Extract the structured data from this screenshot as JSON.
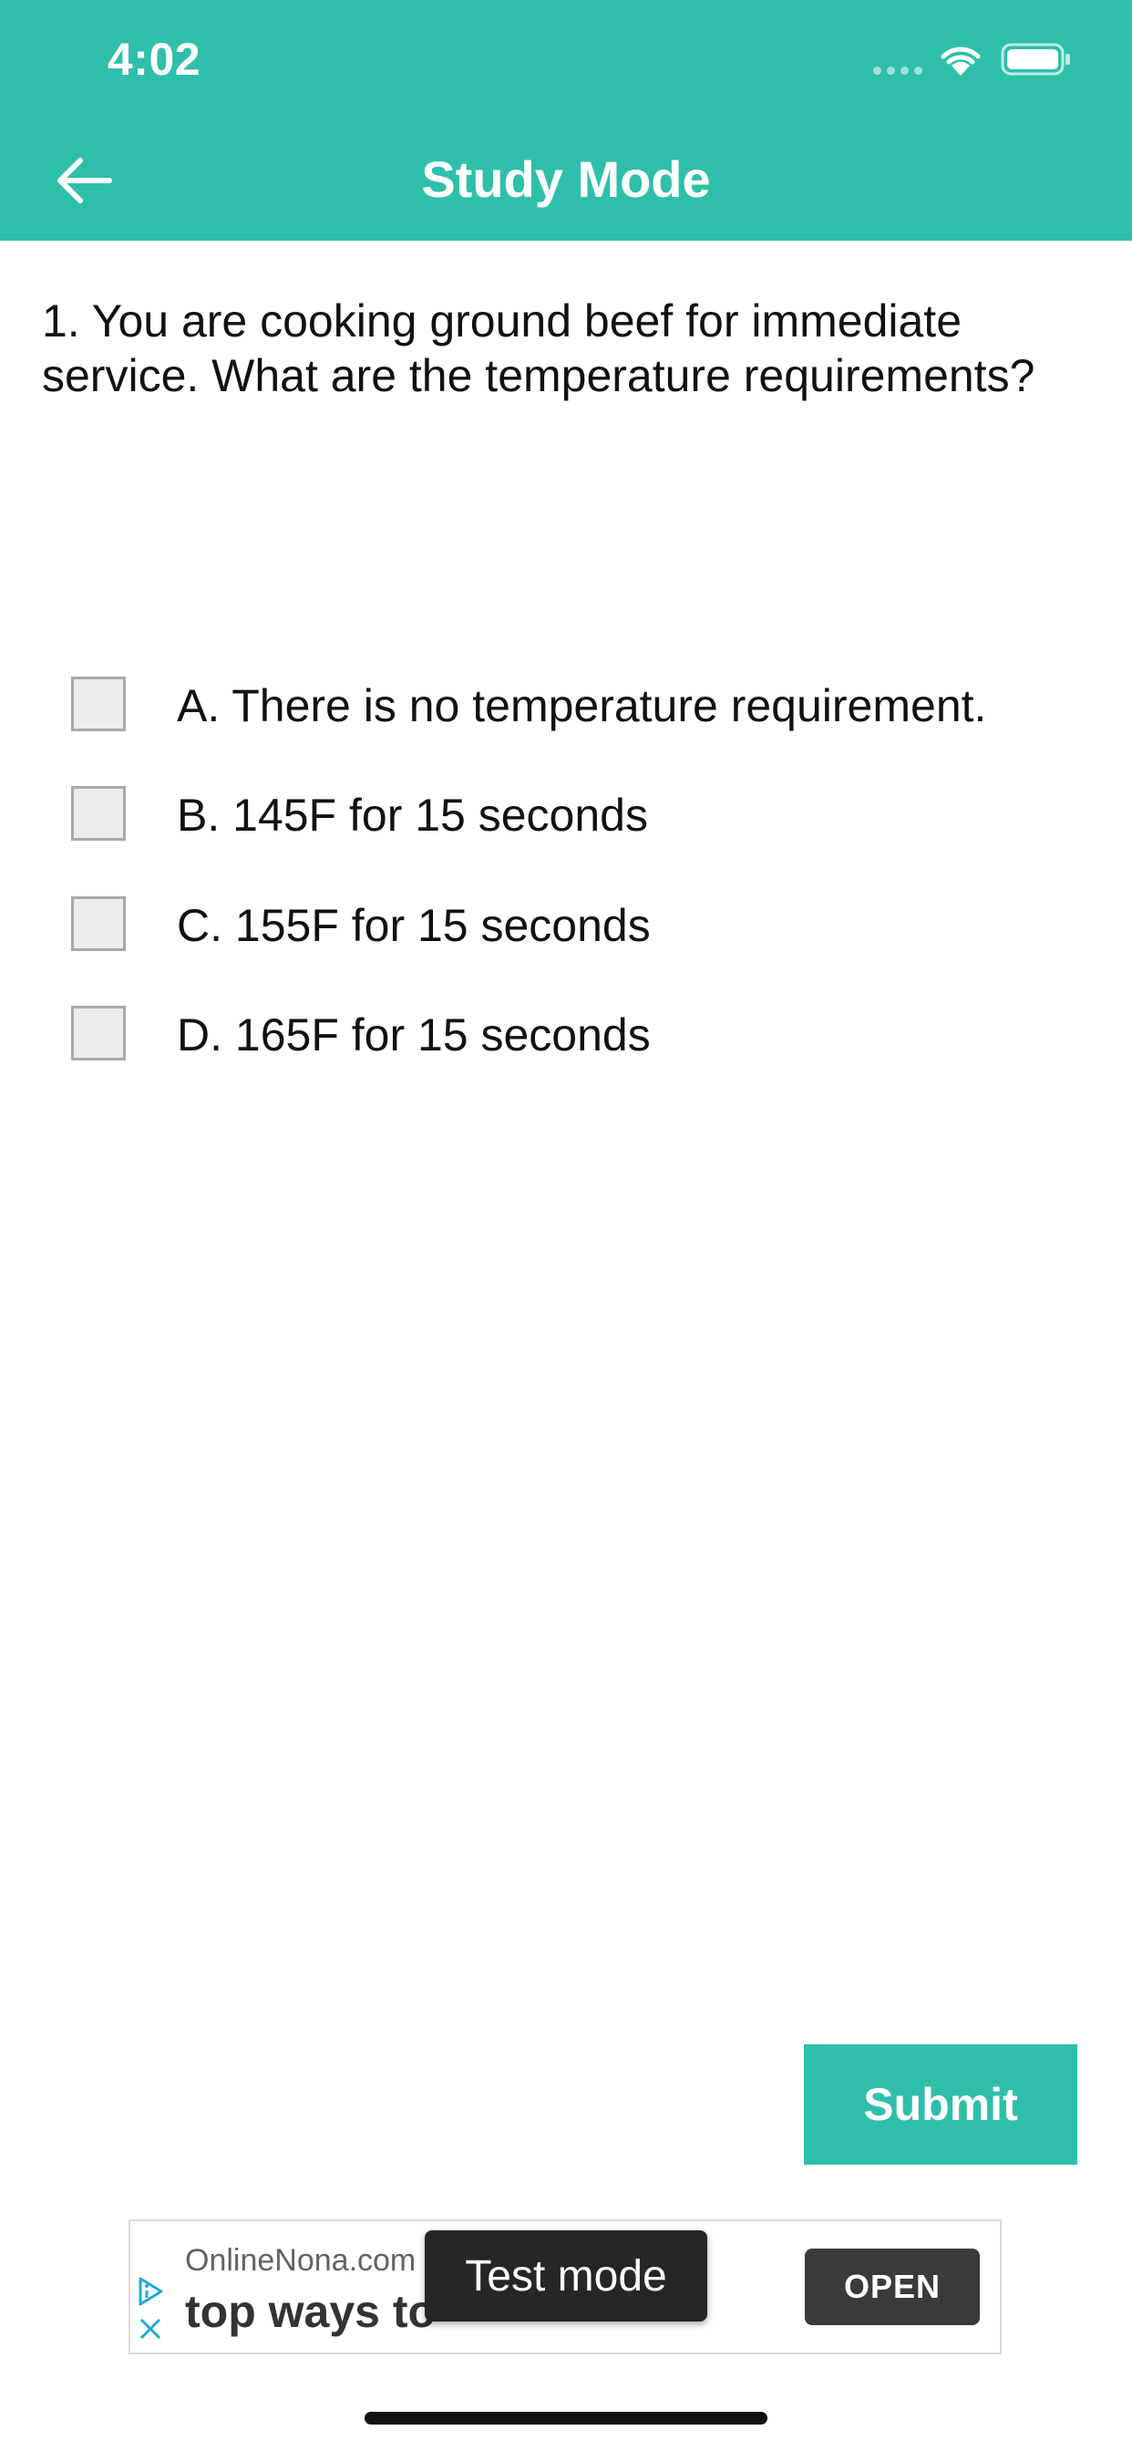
{
  "status_bar": {
    "time": "4:02",
    "icons": [
      "cellular-signal-icon",
      "wifi-icon",
      "battery-icon"
    ]
  },
  "nav": {
    "title": "Study Mode",
    "back_icon": "back-arrow-icon"
  },
  "question": {
    "text": "1. You are cooking ground beef for immediate service. What are the temperature requirements?"
  },
  "options": [
    {
      "label": "A. There is no temperature requirement.",
      "checked": false
    },
    {
      "label": "B. 145F for 15 seconds",
      "checked": false
    },
    {
      "label": "C. 155F for 15 seconds",
      "checked": false
    },
    {
      "label": "D. 165F for 15 seconds",
      "checked": false
    }
  ],
  "submit": {
    "label": "Submit"
  },
  "ad": {
    "domain": "OnlineNona.com",
    "headline": "top ways to",
    "open_label": "OPEN",
    "badge": "Test mode",
    "choices_icon": "ad-choices-icon",
    "close_icon": "close-icon"
  },
  "colors": {
    "accent": "#2ebfaa",
    "checkbox_fill": "#ececec",
    "checkbox_border": "#a9a9a9",
    "ad_button": "#3b3b3b"
  }
}
